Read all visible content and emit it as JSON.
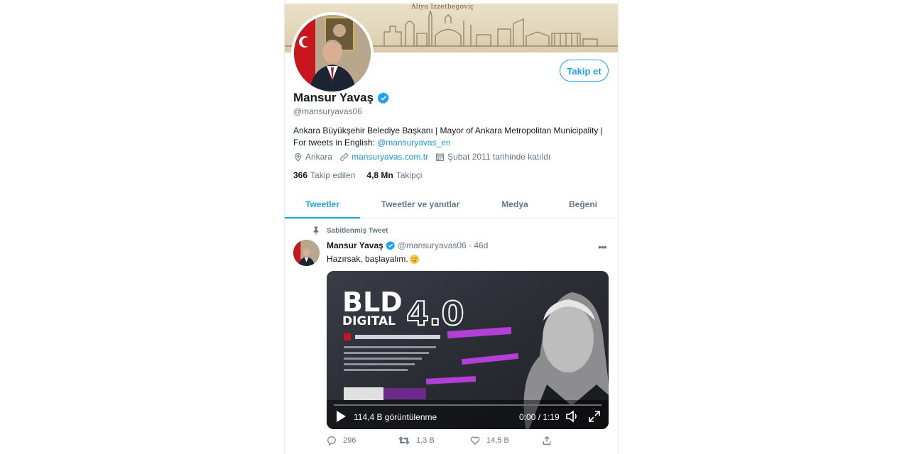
{
  "profile": {
    "banner_caption": "Aliya İzzetbegoviç",
    "name": "Mansur Yavaş",
    "handle": "@mansuryavas06",
    "bio_text": "Ankara Büyükşehir Belediye Başkanı | Mayor of Ankara Metropolitan Municipality | For tweets in English: ",
    "bio_link": "@mansuryavas_en",
    "location": "Ankara",
    "website": "mansuryavas.com.tr",
    "joined": "Şubat 2011 tarihinde katıldı",
    "following_count": "366",
    "following_label": "Takip edilen",
    "followers_count": "4,8 Mn",
    "followers_label": "Takipçi",
    "follow_button": "Takip et"
  },
  "tabs": [
    {
      "label": "Tweetler",
      "active": true
    },
    {
      "label": "Tweetler ve yanıtlar",
      "active": false
    },
    {
      "label": "Medya",
      "active": false
    },
    {
      "label": "Beğeni",
      "active": false
    }
  ],
  "tweet": {
    "pinned_label": "Sabitlenmiş Tweet",
    "name": "Mansur Yavaş",
    "handle_time": "@mansuryavas06 · 46d",
    "text": "Hazırsak, başlayalım.",
    "video": {
      "title_line1": "BLD",
      "title_line2": "DIGITAL",
      "version": "4.0",
      "views": "114,4 B görüntülenme",
      "time": "0:00 / 1:19"
    },
    "replies": "296",
    "retweets": "1,3 B",
    "likes": "14,5 B"
  },
  "colors": {
    "accent": "#1da1f2",
    "link": "#1b95e0",
    "muted": "#657786",
    "text": "#14171a"
  }
}
